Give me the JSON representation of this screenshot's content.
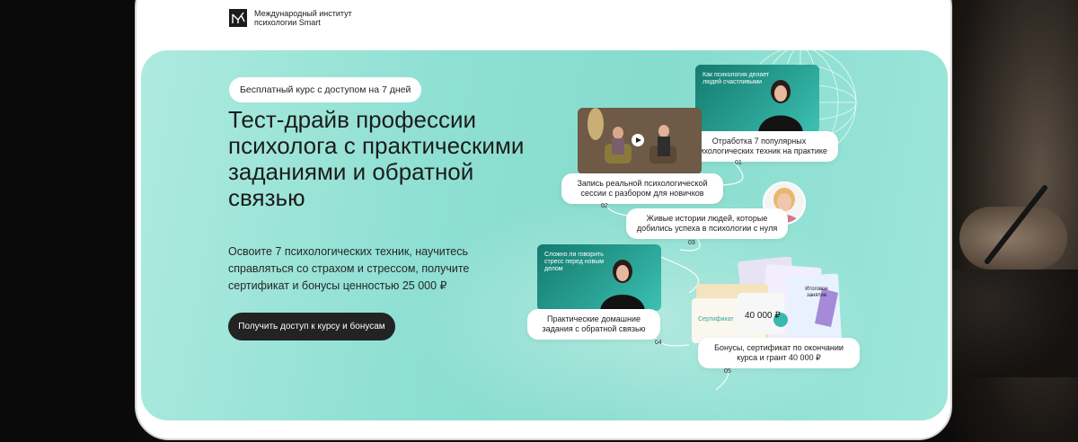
{
  "logo": {
    "line1": "Международный институт",
    "line2": "психологии Smart"
  },
  "hero": {
    "badge": "Бесплатный курс с доступом на 7 дней",
    "title": "Тест-драйв профессии психолога с практическими заданиями и обратной связью",
    "subtitle": "Освоите 7 психологических техник, научитесь справляться со страхом и стрессом, получите сертификат и бонусы ценностью 25 000 ₽",
    "cta": "Получить доступ к курсу и бонусам"
  },
  "features": [
    {
      "num": "01",
      "label": "Отработка 7 популярных психологических техник на практике",
      "card_caption": "Как психология делает людей счастливыми"
    },
    {
      "num": "02",
      "label": "Запись реальной психологической сессии с разбором для новичков"
    },
    {
      "num": "03",
      "label": "Живые истории людей, которые добились успеха в психологии с нуля"
    },
    {
      "num": "04",
      "label": "Практические домашние задания с обратной связью",
      "card_caption": "Сложно ли говорить стресс перед новым делом"
    },
    {
      "num": "05",
      "label": "Бонусы, сертификат по окончании курса и грант 40 000 ₽"
    }
  ],
  "docs": {
    "cert": "Сертификат",
    "grant": "40 000 ₽",
    "extra": "Итоговое занятие"
  },
  "colors": {
    "hero_bg": "#8fe0d3",
    "accent_dark": "#232323",
    "card_teal": "#1f8a80"
  }
}
